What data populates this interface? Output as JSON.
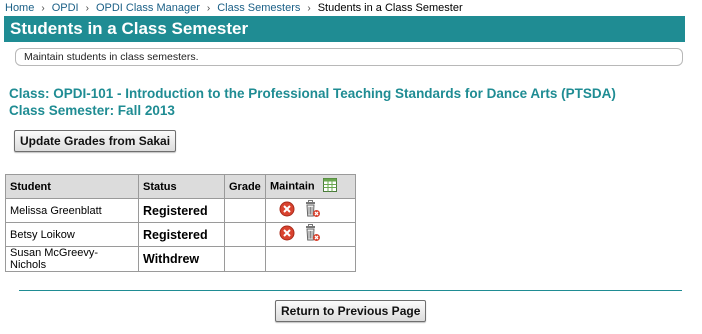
{
  "breadcrumb": {
    "items": [
      "Home",
      "OPDI",
      "OPDI Class Manager",
      "Class Semesters"
    ],
    "current": "Students in a Class Semester"
  },
  "header": {
    "title": "Students in a Class Semester"
  },
  "info": {
    "text": "Maintain students in class semesters."
  },
  "class_info": {
    "class_line": "Class: OPDI-101 - Introduction to the Professional Teaching Standards for Dance Arts (PTSDA)",
    "semester_line": "Class Semester: Fall 2013"
  },
  "buttons": {
    "update_grades": "Update Grades from Sakai",
    "return": "Return to Previous Page"
  },
  "table": {
    "headers": {
      "student": "Student",
      "status": "Status",
      "grade": "Grade",
      "maintain": "Maintain"
    },
    "rows": [
      {
        "student": "Melissa Greenblatt",
        "status": "Registered",
        "grade": "",
        "actions": [
          "remove-icon",
          "trash-icon"
        ]
      },
      {
        "student": "Betsy Loikow",
        "status": "Registered",
        "grade": "",
        "actions": [
          "remove-icon",
          "trash-icon"
        ]
      },
      {
        "student": "Susan McGreevy-Nichols",
        "status": "Withdrew",
        "grade": "",
        "actions": []
      }
    ]
  },
  "colors": {
    "accent": "#1f8c93",
    "link": "#1a5f86",
    "remove": "#d9432f"
  }
}
